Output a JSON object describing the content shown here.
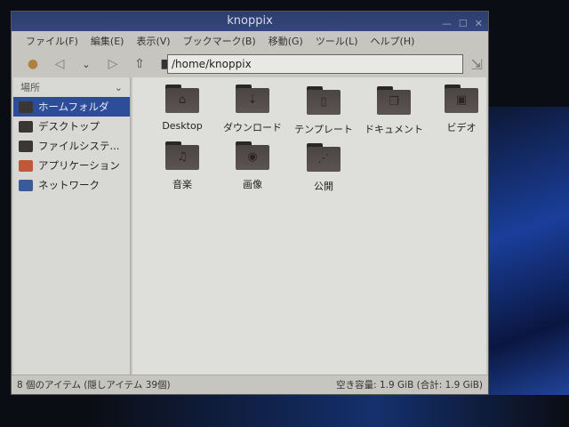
{
  "window": {
    "title": "knoppix"
  },
  "menu": [
    "ファイル(F)",
    "編集(E)",
    "表示(V)",
    "ブックマーク(B)",
    "移動(G)",
    "ツール(L)",
    "ヘルプ(H)"
  ],
  "toolbar": {
    "path": "/home/knoppix"
  },
  "sidebar": {
    "header": "場所",
    "items": [
      {
        "label": "ホームフォルダ",
        "color": "#3a3634"
      },
      {
        "label": "デスクトップ",
        "color": "#3a3634"
      },
      {
        "label": "ファイルシステ...",
        "color": "#3a3634"
      },
      {
        "label": "アプリケーション",
        "color": "#c0583a"
      },
      {
        "label": "ネットワーク",
        "color": "#3a5a9a"
      }
    ]
  },
  "files": [
    {
      "label": "Desktop",
      "glyph": "⌂"
    },
    {
      "label": "ダウンロード",
      "glyph": "⇣"
    },
    {
      "label": "テンプレート",
      "glyph": "▯"
    },
    {
      "label": "ドキュメント",
      "glyph": "❐"
    },
    {
      "label": "ビデオ",
      "glyph": "▣"
    },
    {
      "label": "音楽",
      "glyph": "♫"
    },
    {
      "label": "画像",
      "glyph": "◉"
    },
    {
      "label": "公開",
      "glyph": "⋰"
    }
  ],
  "status": {
    "left": "8 個のアイテム (隠しアイテム 39個)",
    "right": "空き容量: 1.9 GiB (合計: 1.9 GiB)"
  }
}
